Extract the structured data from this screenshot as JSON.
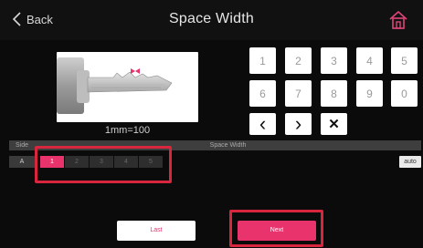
{
  "header": {
    "back_label": "Back",
    "title": "Space Width"
  },
  "preview": {
    "scale_label": "1mm=100"
  },
  "keypad": {
    "digits": [
      "1",
      "2",
      "3",
      "4",
      "5",
      "6",
      "7",
      "8",
      "9",
      "0"
    ],
    "arrow_left": "‹",
    "arrow_right": "›",
    "clear": "✕"
  },
  "table": {
    "side_header": "Side",
    "space_width_header": "Space Width",
    "row_side": "A",
    "cells": [
      "1",
      "2",
      "3",
      "4",
      "5"
    ],
    "active_cell": "1",
    "auto_label": "auto"
  },
  "footer": {
    "last_label": "Last",
    "next_label": "Next"
  },
  "colors": {
    "accent": "#e8336d",
    "highlight": "#d8263f",
    "home_icon": "#e0457a"
  }
}
